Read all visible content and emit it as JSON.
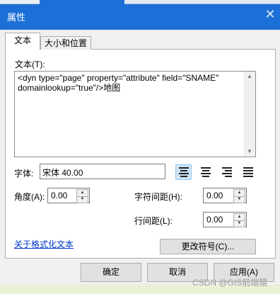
{
  "window": {
    "title": "属性",
    "close_glyph": "✕"
  },
  "tabs": [
    {
      "label": "文本",
      "selected": true
    },
    {
      "label": "大小和位置",
      "selected": false
    }
  ],
  "text_section": {
    "label": "文本(T):",
    "value": "<dyn type=\"page\" property=\"attribute\" field=\"SNAME\"\ndomainlookup=\"true\"/>地图"
  },
  "font": {
    "label": "字体:",
    "value": "宋体 40.00"
  },
  "alignment": {
    "selected": "left",
    "options": [
      "left",
      "center",
      "right",
      "justify"
    ]
  },
  "angle": {
    "label": "角度(A):",
    "value": "0.00"
  },
  "char_spacing": {
    "label": "字符间距(H):",
    "value": "0.00"
  },
  "line_spacing": {
    "label": "行间距(L):",
    "value": "0.00"
  },
  "links": {
    "format_text": "关于格式化文本"
  },
  "buttons": {
    "change_symbol": "更改符号(C)...",
    "ok": "确定",
    "cancel": "取消",
    "apply": "应用(A)"
  },
  "watermark": "CSDN @GIS前端猿",
  "colors": {
    "titlebar": "#1c6fd6",
    "selected_align": "#cce4f7",
    "link": "#0033cc"
  }
}
